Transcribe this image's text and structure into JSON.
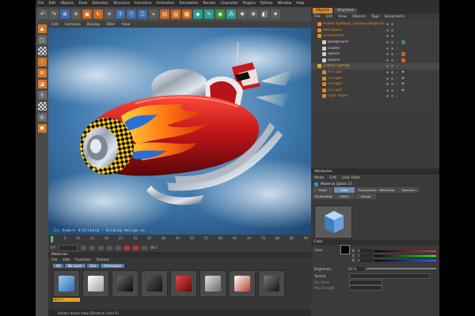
{
  "menubar": [
    "File",
    "Edit",
    "Objects",
    "Tools",
    "Selection",
    "Structure",
    "Functions",
    "Animation",
    "Simulation",
    "Render",
    "Character",
    "Plugins",
    "Python",
    "Window",
    "Help"
  ],
  "viewport": {
    "menu": [
      "Edit",
      "Cameras",
      "Display",
      "Filter",
      "View"
    ],
    "caption": "(c) Anders Kjellberg - display-design.se"
  },
  "timeline": {
    "ticks": [
      "0",
      "5",
      "10",
      "15",
      "20",
      "25",
      "30",
      "35",
      "40",
      "45",
      "50",
      "55",
      "60",
      "65",
      "70",
      "75",
      "80",
      "85",
      "90"
    ],
    "start": "0 F",
    "end": "90 F"
  },
  "materials": {
    "title": "Materials",
    "menu": [
      "File",
      "Edit",
      "Function",
      "Texture"
    ],
    "tabs": [
      "All",
      "No Layer",
      "Env",
      "Rennspace"
    ],
    "label": "glass 1",
    "swatches": [
      {
        "color": "#4a86c8"
      },
      {
        "color": "#cfcfcf"
      },
      {
        "color": "#1a1a1a"
      },
      {
        "color": "#222222"
      },
      {
        "color": "#8f1c1c"
      },
      {
        "color": "#9a9a9a"
      },
      {
        "color": "#dcdcdc"
      },
      {
        "color": "#2a2a2a"
      }
    ]
  },
  "status": "Render Active View [Shortcut Cmd+R]",
  "objects": {
    "tabs": [
      "Objects",
      "Structure"
    ],
    "menu": [
      "File",
      "Edit",
      "View",
      "Objects",
      "Tags",
      "Bookmarks"
    ],
    "rows": [
      {
        "label": "Anders Kjellberg | display-design.se",
        "indent": 1,
        "color": "#e88a2c"
      },
      {
        "label": "Rennspace",
        "indent": 1,
        "color": "#e88a2c"
      },
      {
        "label": "Environment",
        "indent": 1,
        "color": "#e88a2c"
      },
      {
        "label": "Background",
        "indent": 2,
        "color": "#d0d0d0"
      },
      {
        "label": "Cluster",
        "indent": 2,
        "color": "#d0d0d0"
      },
      {
        "label": "Sphere",
        "indent": 2,
        "color": "#d0d0d0"
      },
      {
        "label": "Sphere",
        "indent": 2,
        "color": "#d0d0d0"
      },
      {
        "label": "3 Point Lighting",
        "indent": 1,
        "color": "#e8a52c"
      },
      {
        "label": "Fill Light",
        "indent": 2,
        "color": "#d58a2c"
      },
      {
        "label": "Fill Light",
        "indent": 2,
        "color": "#d58a2c"
      },
      {
        "label": "Fill Light",
        "indent": 2,
        "color": "#d58a2c"
      },
      {
        "label": "Fill Light",
        "indent": 2,
        "color": "#d58a2c"
      },
      {
        "label": "Light Target",
        "indent": 2,
        "color": "#d58a2c"
      }
    ]
  },
  "attributes": {
    "title": "Attributes",
    "menu": [
      "Mode",
      "Edit",
      "User Data"
    ],
    "header": "Material [glass 1]",
    "tabs": [
      "Basic",
      "Color",
      "Transparence",
      "Reflection",
      "Specular",
      "Illumination",
      "Editor",
      "Assign"
    ],
    "section": "Color",
    "color_label": "Color",
    "color_rows": [
      {
        "ch": "R",
        "value": "0"
      },
      {
        "ch": "G",
        "value": "0"
      },
      {
        "ch": "B",
        "value": "0"
      }
    ],
    "brightness_label": "Brightness",
    "brightness_value": "100 %",
    "texture_label": "Texture",
    "mix_mode_label": "Mix Mode",
    "mix_strength_label": "Mix Strength"
  }
}
